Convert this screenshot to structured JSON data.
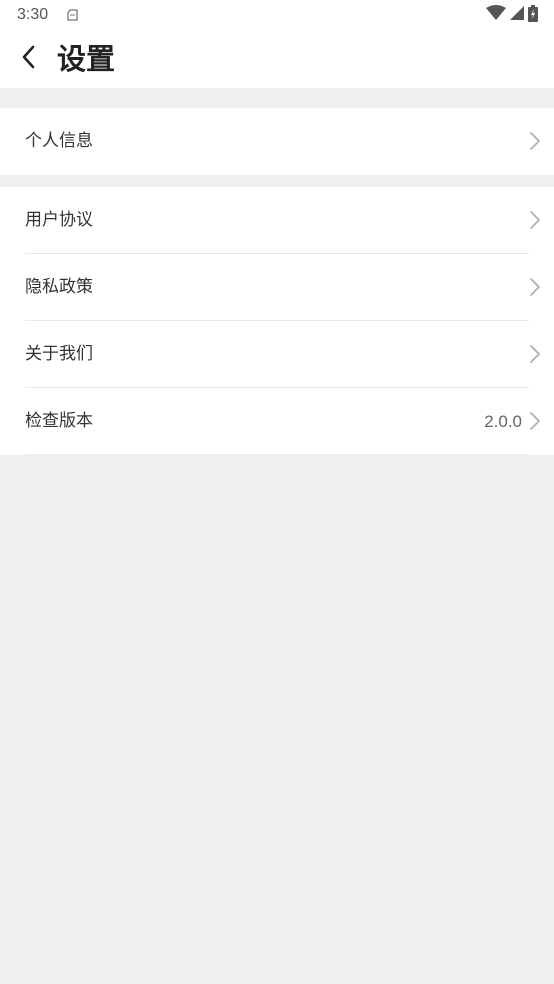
{
  "status_bar": {
    "time": "3:30",
    "icons": [
      "sim-card-icon",
      "wifi-icon",
      "cell-signal-icon",
      "battery-charging-icon"
    ]
  },
  "header": {
    "title": "设置",
    "back_icon": "chevron-left-icon"
  },
  "groups": [
    {
      "items": [
        {
          "label": "个人信息",
          "value": ""
        }
      ]
    },
    {
      "items": [
        {
          "label": "用户协议",
          "value": ""
        },
        {
          "label": "隐私政策",
          "value": ""
        },
        {
          "label": "关于我们",
          "value": ""
        },
        {
          "label": "检查版本",
          "value": "2.0.0"
        }
      ]
    }
  ],
  "colors": {
    "background": "#efefef",
    "surface": "#ffffff",
    "divider": "#e9e9e9",
    "text_primary": "#222222",
    "text_secondary": "#666666",
    "chevron": "#b0b0b0"
  }
}
